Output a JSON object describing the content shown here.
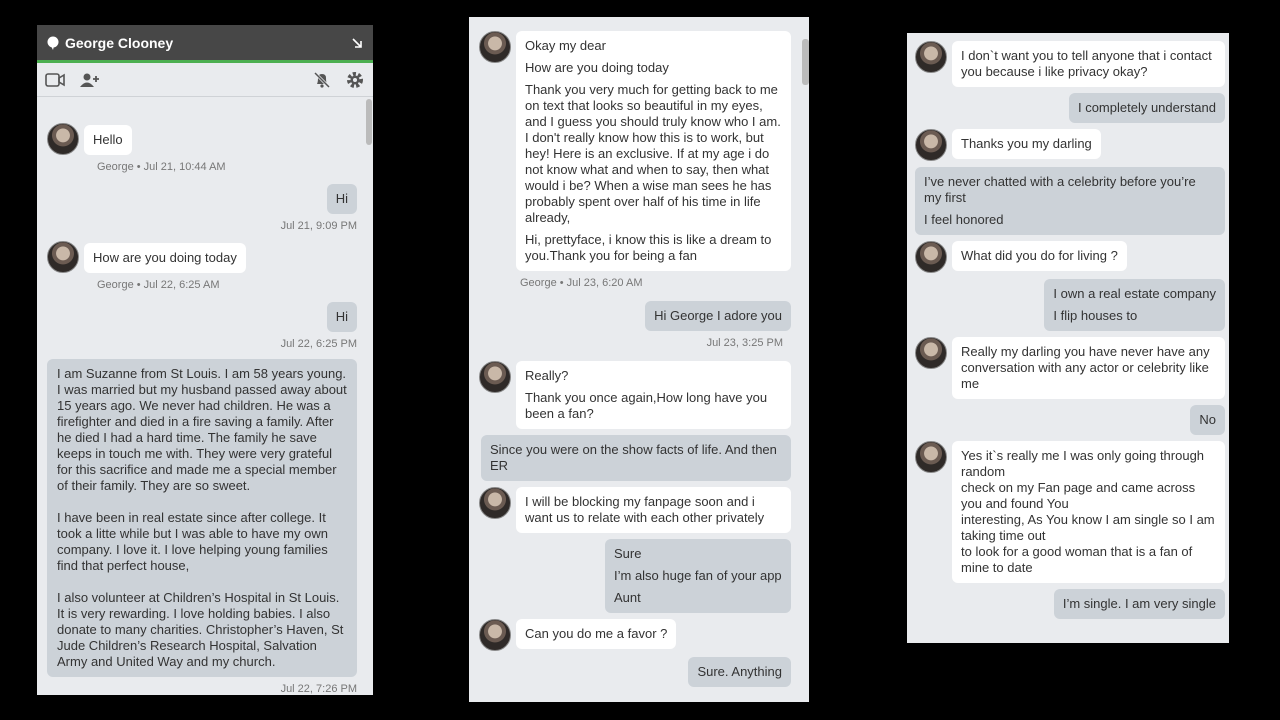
{
  "panel1": {
    "title": "George Clooney",
    "messages": [
      {
        "text": "Hello",
        "meta": "George • Jul 21, 10:44 AM"
      },
      {
        "text": "Hi",
        "meta": "Jul 21, 9:09 PM"
      },
      {
        "text": "How are you doing today",
        "meta": "George • Jul 22, 6:25 AM"
      },
      {
        "text": "Hi",
        "meta": "Jul 22, 6:25 PM"
      },
      {
        "p1": "I am Suzanne from St Louis. I am 58 years young. I was married but my husband passed away about 15 years ago. We never had children. He was a firefighter and died in a fire saving a family. After he died I had a hard time. The family he save keeps in touch me with. They were very grateful for this sacrifice and made me a special member of their family. They are so sweet.",
        "p2": "I have been in real estate since after college. It took a litte while but I was able to have my own company. I love it. I love helping young families find that perfect house,",
        "p3": "I also volunteer at Children’s Hospital in St Louis. It is very rewarding. I love holding babies. I also donate to many charities. Christopher’s Haven, St Jude Children’s Research Hospital, Salvation Army and United Way and my church.",
        "meta": "Jul 22, 7:26 PM"
      }
    ]
  },
  "panel2": {
    "m1": {
      "a": "Okay my dear",
      "b": "How are you doing today",
      "c": "Thank you very much for getting back to me on text that looks so beautiful in my eyes, and I guess you should truly know who I am. I don't really know how this is to work, but hey! Here is an exclusive. If at my age i do not know what and when to say, then what would i be? When a wise man sees he has probably spent over half of his time in life already,",
      "d": "Hi, prettyface, i know this is like a dream to you.Thank you for being a fan",
      "meta": "George • Jul 23, 6:20 AM"
    },
    "m2": {
      "text": "Hi George I adore you",
      "meta": "Jul 23, 3:25 PM"
    },
    "m3": {
      "a": "Really?",
      "b": "Thank you once again,How long have you been a fan?"
    },
    "m4": {
      "text": "Since you were on the show facts of life. And then ER"
    },
    "m5": {
      "text": "I will be blocking my fanpage soon and i want us to relate with each other privately"
    },
    "m6": {
      "a": "Sure",
      "b": "I’m also huge fan of your app",
      "c": "Aunt"
    },
    "m7": {
      "text": "Can you do me a favor ?"
    },
    "m8": {
      "text": "Sure. Anything"
    }
  },
  "panel3": {
    "m1": "I don`t want you to tell anyone that i contact you because i like privacy okay?",
    "m2": "I completely understand",
    "m3": "Thanks you my darling",
    "m4a": "I’ve never chatted with a celebrity before you’re my first",
    "m4b": "I feel honored",
    "m5": "What did you do for living ?",
    "m6a": "I own a real estate company",
    "m6b": "I flip houses to",
    "m7": "Really my darling you have never have any conversation with any actor or celebrity like me",
    "m8": "No",
    "m9a": "Yes it`s really me I was only going through random",
    "m9b": "check on my Fan page and came across you and found You",
    "m9c": "interesting, As You know I am single so I am taking time out",
    "m9d": "to look for a good woman that is a fan of mine to date",
    "m10": "I’m single. I am very single"
  },
  "icons": [
    "chat-bubble-icon",
    "resize-arrow-icon",
    "video-camera-icon",
    "add-person-icon",
    "mute-bell-icon",
    "gear-icon"
  ]
}
